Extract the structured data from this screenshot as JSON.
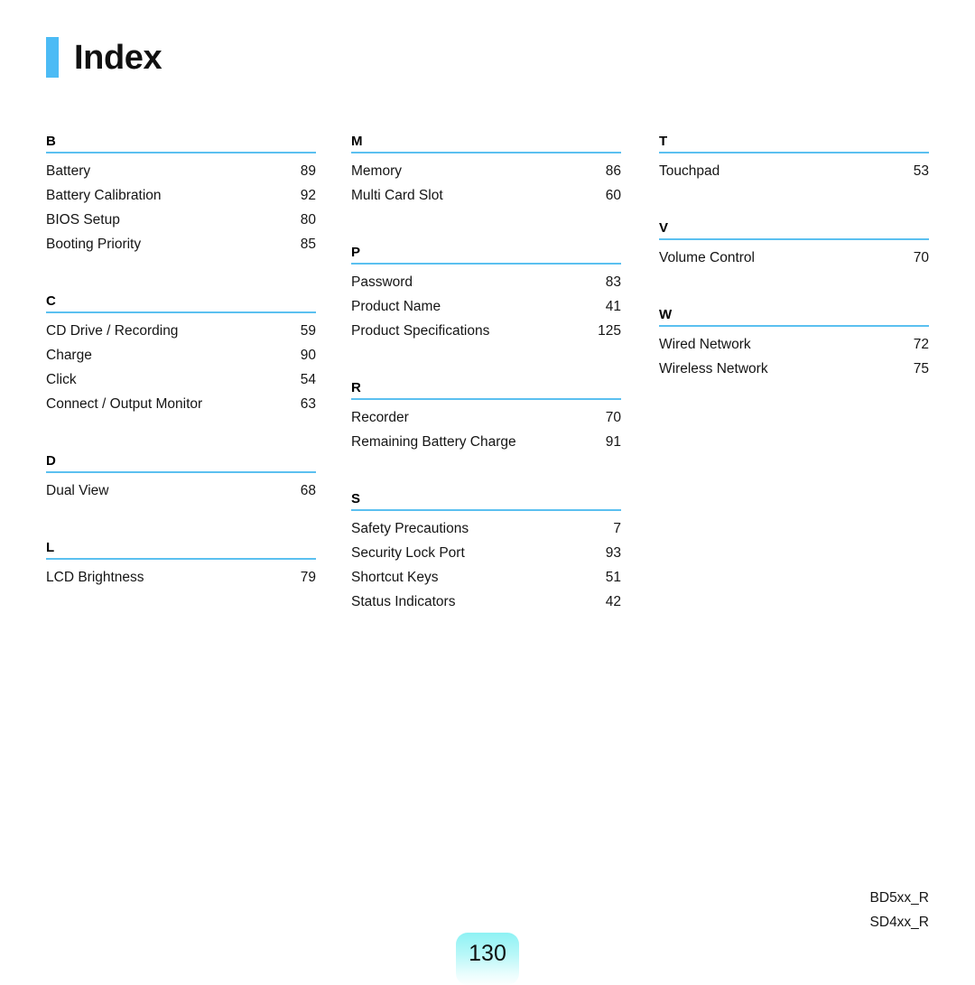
{
  "header": {
    "title": "Index",
    "accent_color": "#4cbbf5"
  },
  "styles": {
    "rule_color": "#5bc0f0",
    "badge_color": "#8ef2f4"
  },
  "columns": [
    {
      "sections": [
        {
          "letter": "B",
          "entries": [
            {
              "label": "Battery",
              "page": "89"
            },
            {
              "label": "Battery Calibration",
              "page": "92"
            },
            {
              "label": "BIOS Setup",
              "page": "80"
            },
            {
              "label": "Booting Priority",
              "page": "85"
            }
          ]
        },
        {
          "letter": "C",
          "entries": [
            {
              "label": "CD Drive / Recording",
              "page": "59"
            },
            {
              "label": "Charge",
              "page": "90"
            },
            {
              "label": "Click",
              "page": "54"
            },
            {
              "label": "Connect / Output Monitor",
              "page": "63"
            }
          ]
        },
        {
          "letter": "D",
          "entries": [
            {
              "label": "Dual View",
              "page": "68"
            }
          ]
        },
        {
          "letter": "L",
          "entries": [
            {
              "label": "LCD Brightness",
              "page": "79"
            }
          ]
        }
      ]
    },
    {
      "sections": [
        {
          "letter": "M",
          "entries": [
            {
              "label": "Memory",
              "page": "86"
            },
            {
              "label": "Multi Card Slot",
              "page": "60"
            }
          ]
        },
        {
          "letter": "P",
          "entries": [
            {
              "label": "Password",
              "page": "83"
            },
            {
              "label": "Product Name",
              "page": "41"
            },
            {
              "label": "Product Specifications",
              "page": "125"
            }
          ]
        },
        {
          "letter": "R",
          "entries": [
            {
              "label": "Recorder",
              "page": "70"
            },
            {
              "label": "Remaining Battery Charge",
              "page": "91"
            }
          ]
        },
        {
          "letter": "S",
          "entries": [
            {
              "label": "Safety Precautions",
              "page": "7"
            },
            {
              "label": "Security Lock Port",
              "page": "93"
            },
            {
              "label": "Shortcut Keys",
              "page": "51"
            },
            {
              "label": "Status Indicators",
              "page": "42"
            }
          ]
        }
      ]
    },
    {
      "sections": [
        {
          "letter": "T",
          "entries": [
            {
              "label": "Touchpad",
              "page": "53"
            }
          ]
        },
        {
          "letter": "V",
          "entries": [
            {
              "label": "Volume Control",
              "page": "70"
            }
          ]
        },
        {
          "letter": "W",
          "entries": [
            {
              "label": "Wired Network",
              "page": "72"
            },
            {
              "label": "Wireless Network",
              "page": "75"
            }
          ]
        }
      ]
    }
  ],
  "footer": {
    "model_codes": [
      "BD5xx_R",
      "SD4xx_R"
    ],
    "page_number": "130"
  }
}
